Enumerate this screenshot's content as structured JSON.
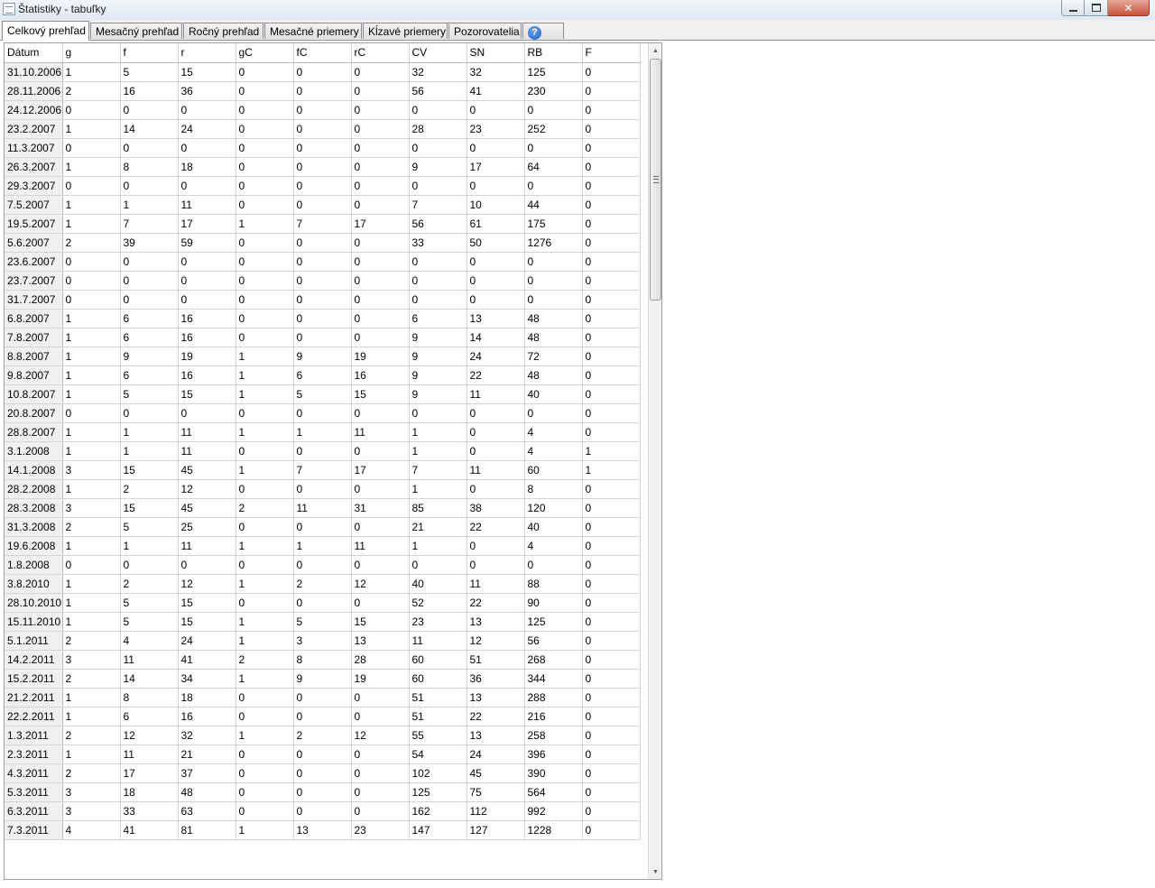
{
  "window": {
    "title": "Štatistiky - tabuľky",
    "minimize_label": "",
    "maximize_label": "",
    "close_label": "✕"
  },
  "tabs": [
    {
      "label": "Celkový prehľad",
      "active": true
    },
    {
      "label": "Mesačný prehľad",
      "active": false
    },
    {
      "label": "Ročný prehľad",
      "active": false
    },
    {
      "label": "Mesačné priemery",
      "active": false
    },
    {
      "label": "Kĺzavé priemery",
      "active": false
    },
    {
      "label": "Pozorovatelia",
      "active": false
    }
  ],
  "help_icon": {
    "name": "help-icon",
    "glyph": "?"
  },
  "table": {
    "columns": [
      "Dátum",
      "g",
      "f",
      "r",
      "gC",
      "fC",
      "rC",
      "CV",
      "SN",
      "RB",
      "F"
    ],
    "rows": [
      [
        "31.10.2006",
        "1",
        "5",
        "15",
        "0",
        "0",
        "0",
        "32",
        "32",
        "125",
        "0"
      ],
      [
        "28.11.2006",
        "2",
        "16",
        "36",
        "0",
        "0",
        "0",
        "56",
        "41",
        "230",
        "0"
      ],
      [
        "24.12.2006",
        "0",
        "0",
        "0",
        "0",
        "0",
        "0",
        "0",
        "0",
        "0",
        "0"
      ],
      [
        "23.2.2007",
        "1",
        "14",
        "24",
        "0",
        "0",
        "0",
        "28",
        "23",
        "252",
        "0"
      ],
      [
        "11.3.2007",
        "0",
        "0",
        "0",
        "0",
        "0",
        "0",
        "0",
        "0",
        "0",
        "0"
      ],
      [
        "26.3.2007",
        "1",
        "8",
        "18",
        "0",
        "0",
        "0",
        "9",
        "17",
        "64",
        "0"
      ],
      [
        "29.3.2007",
        "0",
        "0",
        "0",
        "0",
        "0",
        "0",
        "0",
        "0",
        "0",
        "0"
      ],
      [
        "7.5.2007",
        "1",
        "1",
        "11",
        "0",
        "0",
        "0",
        "7",
        "10",
        "44",
        "0"
      ],
      [
        "19.5.2007",
        "1",
        "7",
        "17",
        "1",
        "7",
        "17",
        "56",
        "61",
        "175",
        "0"
      ],
      [
        "5.6.2007",
        "2",
        "39",
        "59",
        "0",
        "0",
        "0",
        "33",
        "50",
        "1276",
        "0"
      ],
      [
        "23.6.2007",
        "0",
        "0",
        "0",
        "0",
        "0",
        "0",
        "0",
        "0",
        "0",
        "0"
      ],
      [
        "23.7.2007",
        "0",
        "0",
        "0",
        "0",
        "0",
        "0",
        "0",
        "0",
        "0",
        "0"
      ],
      [
        "31.7.2007",
        "0",
        "0",
        "0",
        "0",
        "0",
        "0",
        "0",
        "0",
        "0",
        "0"
      ],
      [
        "6.8.2007",
        "1",
        "6",
        "16",
        "0",
        "0",
        "0",
        "6",
        "13",
        "48",
        "0"
      ],
      [
        "7.8.2007",
        "1",
        "6",
        "16",
        "0",
        "0",
        "0",
        "9",
        "14",
        "48",
        "0"
      ],
      [
        "8.8.2007",
        "1",
        "9",
        "19",
        "1",
        "9",
        "19",
        "9",
        "24",
        "72",
        "0"
      ],
      [
        "9.8.2007",
        "1",
        "6",
        "16",
        "1",
        "6",
        "16",
        "9",
        "22",
        "48",
        "0"
      ],
      [
        "10.8.2007",
        "1",
        "5",
        "15",
        "1",
        "5",
        "15",
        "9",
        "11",
        "40",
        "0"
      ],
      [
        "20.8.2007",
        "0",
        "0",
        "0",
        "0",
        "0",
        "0",
        "0",
        "0",
        "0",
        "0"
      ],
      [
        "28.8.2007",
        "1",
        "1",
        "11",
        "1",
        "1",
        "11",
        "1",
        "0",
        "4",
        "0"
      ],
      [
        "3.1.2008",
        "1",
        "1",
        "11",
        "0",
        "0",
        "0",
        "1",
        "0",
        "4",
        "1"
      ],
      [
        "14.1.2008",
        "3",
        "15",
        "45",
        "1",
        "7",
        "17",
        "7",
        "11",
        "60",
        "1"
      ],
      [
        "28.2.2008",
        "1",
        "2",
        "12",
        "0",
        "0",
        "0",
        "1",
        "0",
        "8",
        "0"
      ],
      [
        "28.3.2008",
        "3",
        "15",
        "45",
        "2",
        "11",
        "31",
        "85",
        "38",
        "120",
        "0"
      ],
      [
        "31.3.2008",
        "2",
        "5",
        "25",
        "0",
        "0",
        "0",
        "21",
        "22",
        "40",
        "0"
      ],
      [
        "19.6.2008",
        "1",
        "1",
        "11",
        "1",
        "1",
        "11",
        "1",
        "0",
        "4",
        "0"
      ],
      [
        "1.8.2008",
        "0",
        "0",
        "0",
        "0",
        "0",
        "0",
        "0",
        "0",
        "0",
        "0"
      ],
      [
        "3.8.2010",
        "1",
        "2",
        "12",
        "1",
        "2",
        "12",
        "40",
        "11",
        "88",
        "0"
      ],
      [
        "28.10.2010",
        "1",
        "5",
        "15",
        "0",
        "0",
        "0",
        "52",
        "22",
        "90",
        "0"
      ],
      [
        "15.11.2010",
        "1",
        "5",
        "15",
        "1",
        "5",
        "15",
        "23",
        "13",
        "125",
        "0"
      ],
      [
        "5.1.2011",
        "2",
        "4",
        "24",
        "1",
        "3",
        "13",
        "11",
        "12",
        "56",
        "0"
      ],
      [
        "14.2.2011",
        "3",
        "11",
        "41",
        "2",
        "8",
        "28",
        "60",
        "51",
        "268",
        "0"
      ],
      [
        "15.2.2011",
        "2",
        "14",
        "34",
        "1",
        "9",
        "19",
        "60",
        "36",
        "344",
        "0"
      ],
      [
        "21.2.2011",
        "1",
        "8",
        "18",
        "0",
        "0",
        "0",
        "51",
        "13",
        "288",
        "0"
      ],
      [
        "22.2.2011",
        "1",
        "6",
        "16",
        "0",
        "0",
        "0",
        "51",
        "22",
        "216",
        "0"
      ],
      [
        "1.3.2011",
        "2",
        "12",
        "32",
        "1",
        "2",
        "12",
        "55",
        "13",
        "258",
        "0"
      ],
      [
        "2.3.2011",
        "1",
        "11",
        "21",
        "0",
        "0",
        "0",
        "54",
        "24",
        "396",
        "0"
      ],
      [
        "4.3.2011",
        "2",
        "17",
        "37",
        "0",
        "0",
        "0",
        "102",
        "45",
        "390",
        "0"
      ],
      [
        "5.3.2011",
        "3",
        "18",
        "48",
        "0",
        "0",
        "0",
        "125",
        "75",
        "564",
        "0"
      ],
      [
        "6.3.2011",
        "3",
        "33",
        "63",
        "0",
        "0",
        "0",
        "162",
        "112",
        "992",
        "0"
      ],
      [
        "7.3.2011",
        "4",
        "41",
        "81",
        "1",
        "13",
        "23",
        "147",
        "127",
        "1228",
        "0"
      ]
    ]
  }
}
